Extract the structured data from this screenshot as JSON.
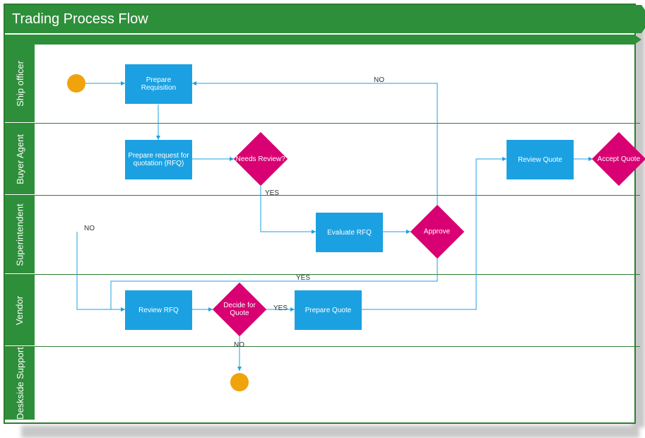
{
  "title": "Trading Process Flow",
  "lanes": [
    {
      "id": "ship-officer",
      "label": "Ship officer"
    },
    {
      "id": "buyer-agent",
      "label": "Buyer Agent"
    },
    {
      "id": "superintendent",
      "label": "Superintendent"
    },
    {
      "id": "vendor",
      "label": "Vendor"
    },
    {
      "id": "deskside-support",
      "label": "Deskside Support"
    }
  ],
  "nodes": {
    "start": {
      "type": "start"
    },
    "prepare_requisition": {
      "type": "process",
      "label": "Prepare Requisition"
    },
    "prepare_rfq": {
      "type": "process",
      "label": "Prepare request for quotation (RFQ)"
    },
    "needs_review": {
      "type": "decision",
      "label": "Needs Review?"
    },
    "evaluate_rfq": {
      "type": "process",
      "label": "Evaluate RFQ"
    },
    "approve": {
      "type": "decision",
      "label": "Approve"
    },
    "review_rfq": {
      "type": "process",
      "label": "Review RFQ"
    },
    "decide_for_quote": {
      "type": "decision",
      "label": "Decide for Quote"
    },
    "prepare_quote": {
      "type": "process",
      "label": "Prepare Quote"
    },
    "review_quote": {
      "type": "process",
      "label": "Review Quote"
    },
    "accept_quote": {
      "type": "decision",
      "label": "Accept Quote"
    },
    "end": {
      "type": "end"
    }
  },
  "edges": {
    "yes": "YES",
    "no": "NO"
  },
  "colors": {
    "laneHeader": "#2e8f3a",
    "process": "#1ba1e2",
    "decision": "#d80073",
    "startEnd": "#f0a30a",
    "connector": "#1ba1e2"
  }
}
